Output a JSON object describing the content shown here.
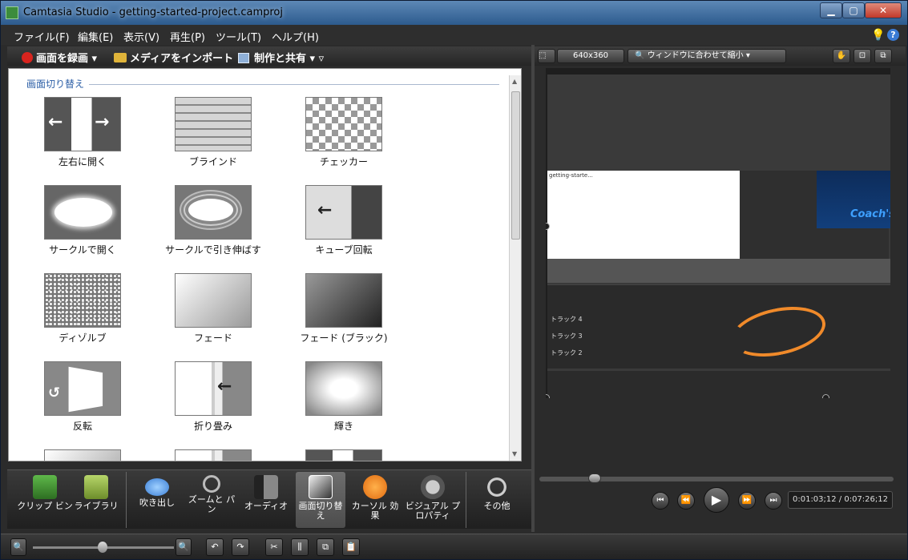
{
  "window": {
    "title": "Camtasia Studio - getting-started-project.camproj"
  },
  "menu": {
    "items": [
      "ファイル(F)",
      "編集(E)",
      "表示(V)",
      "再生(P)",
      "ツール(T)",
      "ヘルプ(H)"
    ]
  },
  "toolbar": {
    "record": "画面を録画",
    "import": "メディアをインポート",
    "share": "制作と共有"
  },
  "library": {
    "group_title": "画面切り替え",
    "items": [
      "左右に開く",
      "ブラインド",
      "チェッカー",
      "サークルで開く",
      "サークルで引き伸ばす",
      "キューブ回転",
      "ディゾルブ",
      "フェード",
      "フェード (ブラック)",
      "反転",
      "折り畳み",
      "輝き"
    ]
  },
  "tabs": {
    "clip_bin": "クリップ ビン",
    "library": "ライブラリ",
    "callouts": "吹き出し",
    "zoom_pan": "ズームと パン",
    "audio": "オーディオ",
    "transitions": "画面切り替え",
    "cursor": "カーソル 効果",
    "visual": "ビジュアル プロパティ",
    "more": "その他"
  },
  "preview": {
    "resolution": "640x360",
    "zoom_mode": "ウィンドウに合わせて縮小",
    "inner_filename": "getting-starte...",
    "coach_text": "Coach's",
    "tracks": [
      "トラック 4",
      "トラック 3",
      "トラック 2"
    ],
    "time": "0:01:03;12 / 0:07:26;12"
  },
  "colors": {
    "accent": "#2b5ea6",
    "cursor_curve": "#f08a2a",
    "record": "#d9241e"
  }
}
